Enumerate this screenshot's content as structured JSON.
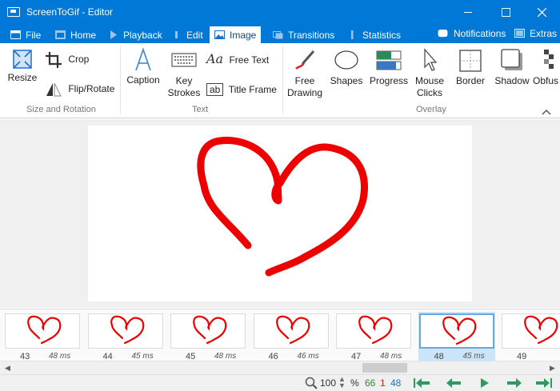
{
  "window": {
    "title": "ScreenToGif - Editor"
  },
  "tabs": [
    {
      "label": "File"
    },
    {
      "label": "Home"
    },
    {
      "label": "Playback"
    },
    {
      "label": "Edit"
    },
    {
      "label": "Image"
    },
    {
      "label": "Transitions"
    },
    {
      "label": "Statistics"
    }
  ],
  "toolbar_right": {
    "notifications": "Notifications",
    "extras": "Extras"
  },
  "ribbon": {
    "size_rotation": {
      "group_label": "Size and Rotation",
      "resize": "Resize",
      "crop": "Crop",
      "flip_rotate": "Flip/Rotate"
    },
    "text": {
      "group_label": "Text",
      "caption": "Caption",
      "key_strokes_1": "Key",
      "key_strokes_2": "Strokes",
      "free_text": "Free Text",
      "title_frame": "Title Frame"
    },
    "overlay": {
      "group_label": "Overlay",
      "free_drawing_1": "Free",
      "free_drawing_2": "Drawing",
      "shapes": "Shapes",
      "progress": "Progress",
      "mouse_clicks_1": "Mouse",
      "mouse_clicks_2": "Clicks",
      "border": "Border",
      "shadow": "Shadow",
      "obfuscate": "Obfus"
    }
  },
  "frames": [
    {
      "number": "43",
      "delay": "48 ms"
    },
    {
      "number": "44",
      "delay": "45 ms"
    },
    {
      "number": "45",
      "delay": "48 ms"
    },
    {
      "number": "46",
      "delay": "46 ms"
    },
    {
      "number": "47",
      "delay": "48 ms"
    },
    {
      "number": "48",
      "delay": "45 ms",
      "selected": true
    },
    {
      "number": "49",
      "delay": ""
    }
  ],
  "status": {
    "zoom": "100",
    "zoom_unit": "%",
    "frame_count": "66",
    "selected_count": "1",
    "current_frame": "48"
  },
  "colors": {
    "accent": "#0078d7",
    "drawing": "#ee0000",
    "frame_count": "#2e8b2e",
    "selected_count": "#d42020",
    "current_frame": "#1c6fd1",
    "nav_arrows": "#2e9a60"
  }
}
